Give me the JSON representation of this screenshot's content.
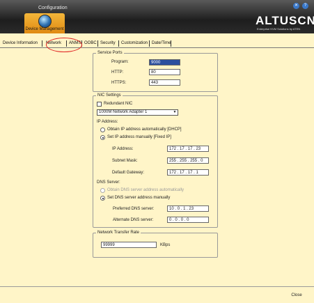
{
  "header": {
    "title": "Configuration",
    "active_section": "Device Management",
    "logo": "ALTUSCN",
    "logo_sub": "Enterprise KVM Solutions by ATEN"
  },
  "tabs": [
    "Device Information",
    "Network",
    "ANMS",
    "OOBC",
    "Security",
    "Customization",
    "Date/Time"
  ],
  "service_ports": {
    "title": "Service Ports",
    "program_label": "Program:",
    "program_value": "9000",
    "http_label": "HTTP:",
    "http_value": "80",
    "https_label": "HTTPS:",
    "https_value": "443"
  },
  "nic": {
    "title": "NIC Settings",
    "redundant_label": "Redundant NIC",
    "adapter_value": "1000M Network Adapter 1",
    "ip_address_title": "IP Address:",
    "dhcp_label": "Obtain IP address automatically [DHCP]",
    "fixed_label": "Set IP address manually [Fixed IP]",
    "ip_label": "IP Address:",
    "ip": [
      "172",
      "17",
      "17",
      "23"
    ],
    "mask_label": "Subnet Mask:",
    "mask": [
      "255",
      "255",
      "255",
      "0"
    ],
    "gateway_label": "Default Gateway:",
    "gateway": [
      "172",
      "17",
      "17",
      "1"
    ],
    "dns_title": "DNS Server:",
    "dns_auto_label": "Obtain DNS server address automatically",
    "dns_manual_label": "Set DNS server address manually",
    "preferred_label": "Preferred DNS server:",
    "preferred": [
      "10",
      "0",
      "1",
      "23"
    ],
    "alternate_label": "Alternate DNS server:",
    "alternate": [
      "0",
      "0",
      "0",
      "0"
    ]
  },
  "transfer": {
    "title": "Network Transfer Rate",
    "value": "99999",
    "unit": "KBps"
  },
  "footer": {
    "close_label": "Close"
  }
}
